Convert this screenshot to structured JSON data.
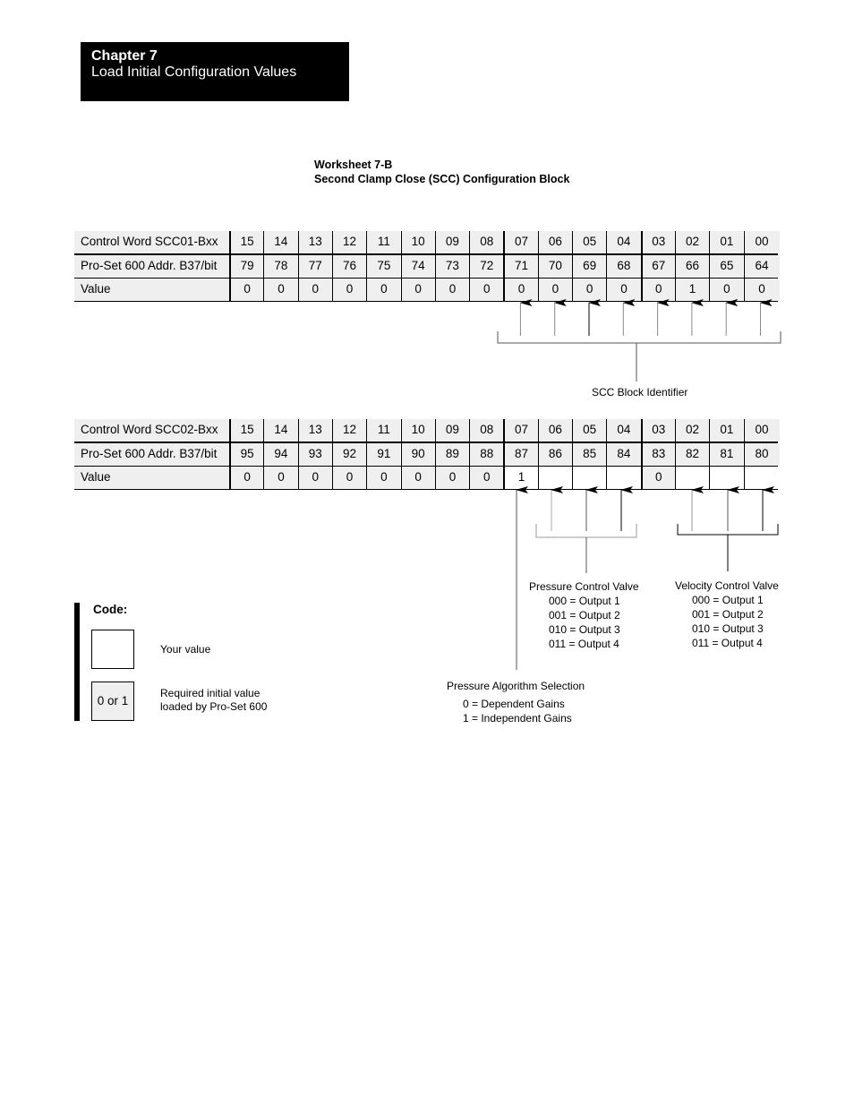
{
  "header": {
    "chapter": "Chapter  7",
    "title": "Load Initial Configuration Values"
  },
  "worksheet": {
    "number": "Worksheet 7-B",
    "title": "Second Clamp Close (SCC) Configuration Block"
  },
  "tables": [
    {
      "rows": [
        {
          "label": "Control Word SCC01-Bxx",
          "cells": [
            "15",
            "14",
            "13",
            "12",
            "11",
            "10",
            "09",
            "08",
            "07",
            "06",
            "05",
            "04",
            "03",
            "02",
            "01",
            "00"
          ]
        },
        {
          "label": "Pro-Set 600 Addr. B37/bit",
          "cells": [
            "79",
            "78",
            "77",
            "76",
            "75",
            "74",
            "73",
            "72",
            "71",
            "70",
            "69",
            "68",
            "67",
            "66",
            "65",
            "64"
          ]
        },
        {
          "label": "Value",
          "cells": [
            "0",
            "0",
            "0",
            "0",
            "0",
            "0",
            "0",
            "0",
            "0",
            "0",
            "0",
            "0",
            "0",
            "1",
            "0",
            "0"
          ]
        }
      ]
    },
    {
      "rows": [
        {
          "label": "Control Word SCC02-Bxx",
          "cells": [
            "15",
            "14",
            "13",
            "12",
            "11",
            "10",
            "09",
            "08",
            "07",
            "06",
            "05",
            "04",
            "03",
            "02",
            "01",
            "00"
          ]
        },
        {
          "label": "Pro-Set 600 Addr. B37/bit",
          "cells": [
            "95",
            "94",
            "93",
            "92",
            "91",
            "90",
            "89",
            "88",
            "87",
            "86",
            "85",
            "84",
            "83",
            "82",
            "81",
            "80"
          ]
        },
        {
          "label": "Value",
          "cells": [
            "0",
            "0",
            "0",
            "0",
            "0",
            "0",
            "0",
            "0",
            "1",
            "",
            "",
            "",
            "0",
            "",
            "",
            ""
          ]
        }
      ]
    }
  ],
  "annotations": {
    "scc_block_identifier": "SCC Block Identifier",
    "pressure_control_valve": {
      "title": "Pressure Control Valve",
      "options": [
        "000 = Output 1",
        "001 = Output 2",
        "010 = Output 3",
        "011 = Output 4"
      ]
    },
    "velocity_control_valve": {
      "title": "Velocity Control Valve",
      "options": [
        "000 = Output 1",
        "001 = Output 2",
        "010 = Output 3",
        "011 = Output 4"
      ]
    },
    "pressure_algorithm": {
      "title": "Pressure Algorithm Selection",
      "options": [
        "0 = Dependent Gains",
        "1 = Independent Gains"
      ]
    }
  },
  "code_legend": {
    "title": "Code:",
    "items": [
      {
        "box": "",
        "text_line1": "Your value",
        "text_line2": ""
      },
      {
        "box": "0 or 1",
        "text_line1": "Required initial value",
        "text_line2": "loaded by Pro-Set 600"
      }
    ]
  }
}
